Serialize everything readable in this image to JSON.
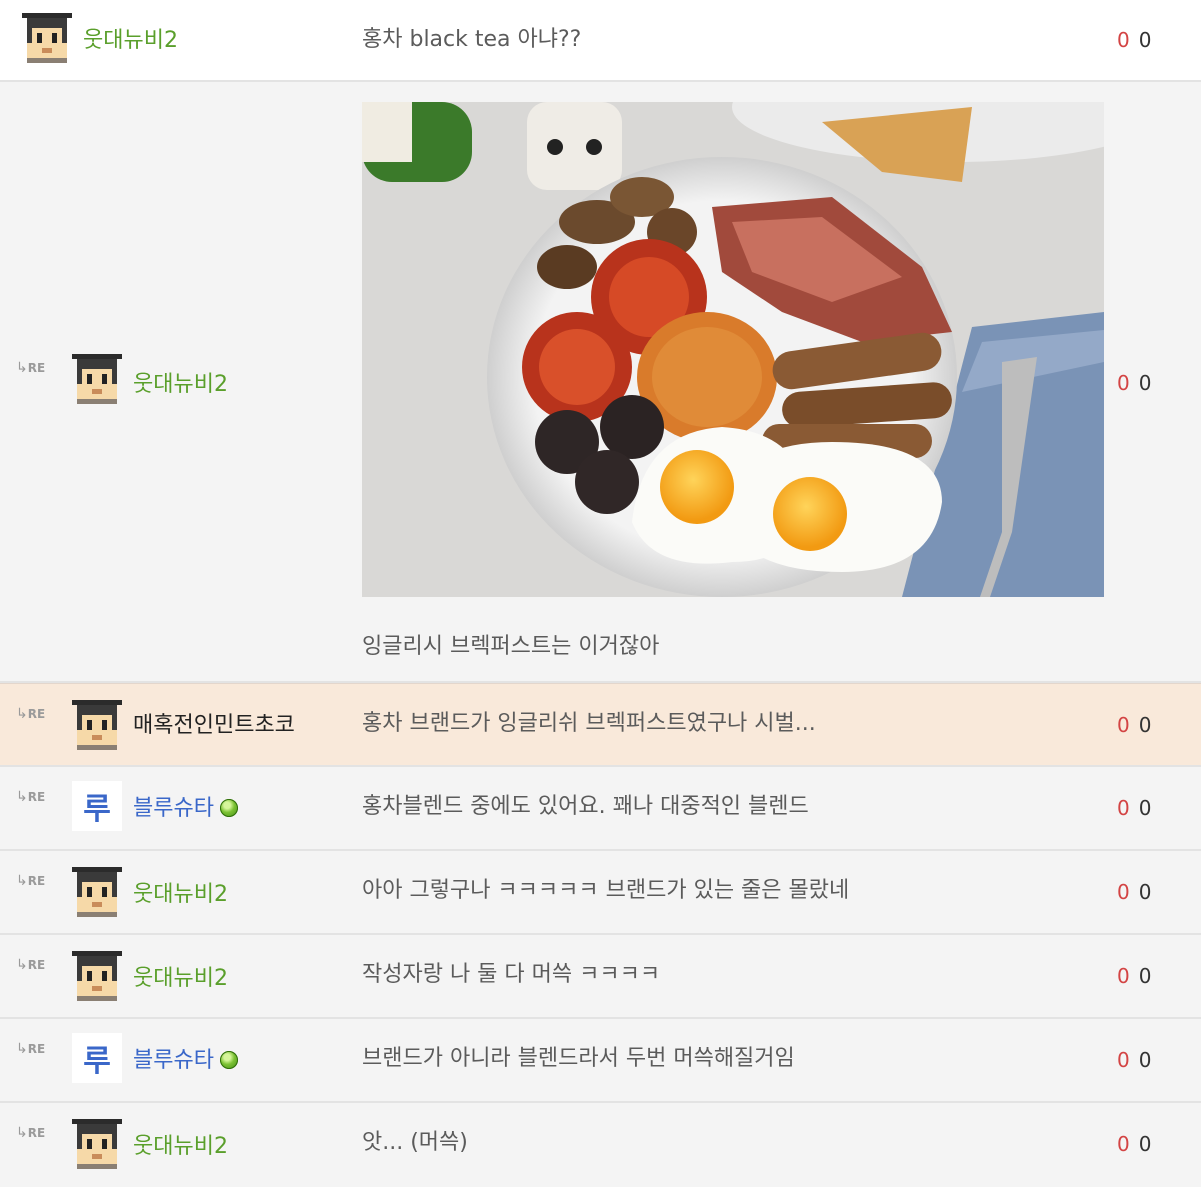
{
  "comments": [
    {
      "reply_marker": "",
      "nick": "웃대뉴비2",
      "text": "홍차 black tea 아냐??",
      "up": "0",
      "down": "0"
    },
    {
      "reply_marker": "RE",
      "nick": "웃대뉴비2",
      "image_alt": "food-photo",
      "text": "잉글리시 브렉퍼스트는 이거잖아",
      "up": "0",
      "down": "0"
    },
    {
      "reply_marker": "RE",
      "nick": "매혹전인민트초코",
      "text": "홍차 브랜드가 잉글리쉬 브렉퍼스트였구나 시벌...",
      "up": "0",
      "down": "0"
    },
    {
      "reply_marker": "RE",
      "nick": "블루슈타",
      "avatar_glyph": "루",
      "text": "홍차블렌드 중에도 있어요. 꽤나 대중적인 블렌드",
      "up": "0",
      "down": "0"
    },
    {
      "reply_marker": "RE",
      "nick": "웃대뉴비2",
      "text": "아아 그렇구나 ㅋㅋㅋㅋㅋ 브랜드가 있는 줄은 몰랐네",
      "up": "0",
      "down": "0"
    },
    {
      "reply_marker": "RE",
      "nick": "웃대뉴비2",
      "text": "작성자랑 나 둘 다 머쓱 ㅋㅋㅋㅋ",
      "up": "0",
      "down": "0"
    },
    {
      "reply_marker": "RE",
      "nick": "블루슈타",
      "avatar_glyph": "루",
      "text": "브랜드가 아니라 블렌드라서 두번 머쓱해질거임",
      "up": "0",
      "down": "0"
    },
    {
      "reply_marker": "RE",
      "nick": "웃대뉴비2",
      "text": "앗... (머쓱)",
      "up": "0",
      "down": "0"
    }
  ],
  "colors": {
    "nick_green": "#5a9f2b",
    "nick_blue": "#3a67c9",
    "upvote_red": "#d34444",
    "highlight_row": "#f9e9da"
  }
}
